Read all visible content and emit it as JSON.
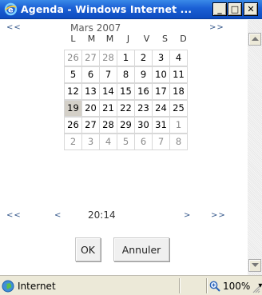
{
  "window": {
    "title": "Agenda - Windows Internet ...",
    "min_glyph": "_",
    "max_glyph": "□",
    "close_glyph": "✕"
  },
  "calendar": {
    "prev_year": "<<",
    "next_year": ">>",
    "month_title": "Mars 2007",
    "weekdays": [
      "L",
      "M",
      "M",
      "J",
      "V",
      "S",
      "D"
    ],
    "weeks": [
      [
        {
          "d": "26",
          "o": true
        },
        {
          "d": "27",
          "o": true
        },
        {
          "d": "28",
          "o": true
        },
        {
          "d": "1"
        },
        {
          "d": "2"
        },
        {
          "d": "3"
        },
        {
          "d": "4"
        }
      ],
      [
        {
          "d": "5"
        },
        {
          "d": "6"
        },
        {
          "d": "7"
        },
        {
          "d": "8"
        },
        {
          "d": "9"
        },
        {
          "d": "10"
        },
        {
          "d": "11"
        }
      ],
      [
        {
          "d": "12"
        },
        {
          "d": "13"
        },
        {
          "d": "14"
        },
        {
          "d": "15"
        },
        {
          "d": "16"
        },
        {
          "d": "17"
        },
        {
          "d": "18"
        }
      ],
      [
        {
          "d": "19",
          "t": true
        },
        {
          "d": "20"
        },
        {
          "d": "21"
        },
        {
          "d": "22"
        },
        {
          "d": "23"
        },
        {
          "d": "24"
        },
        {
          "d": "25"
        }
      ],
      [
        {
          "d": "26"
        },
        {
          "d": "27"
        },
        {
          "d": "28"
        },
        {
          "d": "29"
        },
        {
          "d": "30"
        },
        {
          "d": "31"
        },
        {
          "d": "1",
          "o": true
        }
      ],
      [
        {
          "d": "2",
          "o": true
        },
        {
          "d": "3",
          "o": true
        },
        {
          "d": "4",
          "o": true
        },
        {
          "d": "5",
          "o": true
        },
        {
          "d": "6",
          "o": true
        },
        {
          "d": "7",
          "o": true
        },
        {
          "d": "8",
          "o": true
        }
      ]
    ]
  },
  "time": {
    "prev_hour": "<<",
    "prev_min": "<",
    "value": "20:14",
    "next_min": ">",
    "next_hour": ">>"
  },
  "buttons": {
    "ok": "OK",
    "cancel": "Annuler"
  },
  "status": {
    "zone": "Internet",
    "zoom": "100%",
    "zoom_arrow": "▾"
  },
  "colors": {
    "titlebar": "#1a5fd4",
    "link": "#33568a",
    "today_bg": "#d4d0c8"
  }
}
